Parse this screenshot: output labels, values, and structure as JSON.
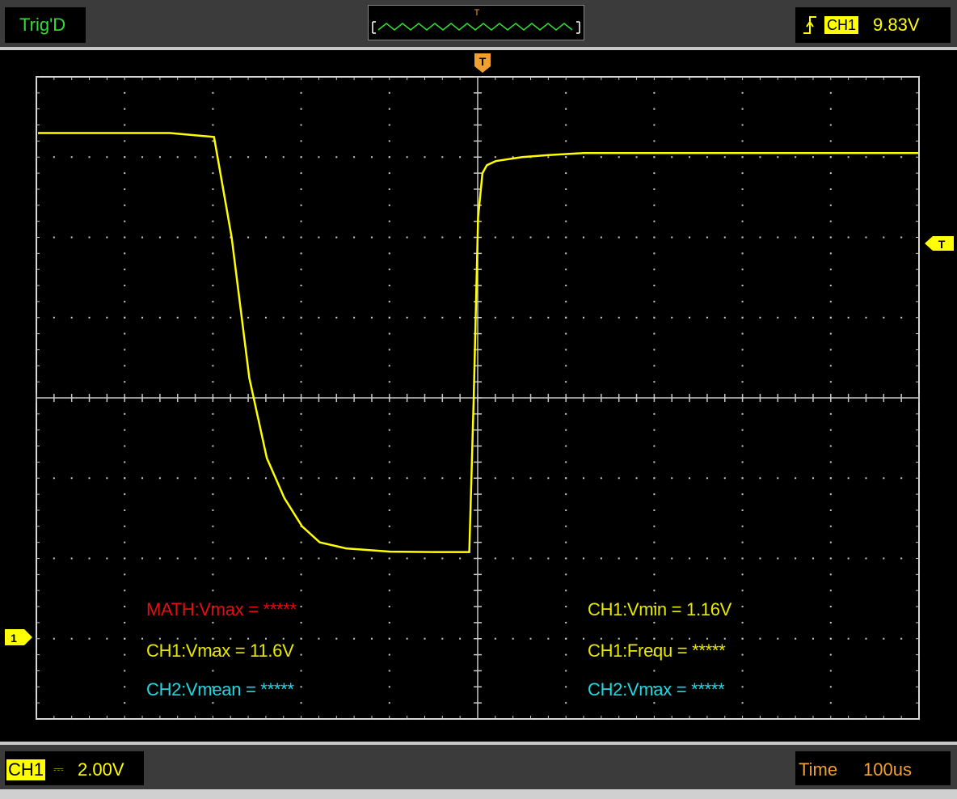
{
  "header": {
    "trigger_status": "Trig'D",
    "timeline_trigger_marker": "T",
    "trigger_source": "CH1",
    "trigger_level": "9.83V",
    "trigger_edge_icon": "rising-edge-icon"
  },
  "markers": {
    "trigger_position": "T",
    "trigger_level_marker": "T",
    "channel1_ground": "1"
  },
  "measurements": {
    "math_vmax": "MATH:Vmax = *****",
    "ch1_vmax": "CH1:Vmax = 11.6V",
    "ch2_vmean": "CH2:Vmean = *****",
    "ch1_vmin": "CH1:Vmin = 1.16V",
    "ch1_frequ": "CH1:Frequ = *****",
    "ch2_vmax": "CH2:Vmax = *****"
  },
  "footer": {
    "channel": "CH1",
    "coupling": "⎓",
    "volts_per_div": "2.00V",
    "time_label": "Time",
    "time_per_div": "100us"
  },
  "colors": {
    "ch1": "#ffff00",
    "ch2": "#20d8e0",
    "math": "#e01010",
    "trigger": "#f0a030",
    "status_ok": "#33dd33",
    "grid": "#c8c8c8"
  },
  "chart_data": {
    "type": "line",
    "series": [
      {
        "name": "CH1",
        "x": [
          -500,
          -350,
          -300,
          -280,
          -260,
          -240,
          -220,
          -200,
          -180,
          -150,
          -100,
          -50,
          -20,
          -10,
          -5,
          0,
          5,
          10,
          20,
          50,
          80,
          120,
          200,
          300,
          400,
          500
        ],
        "y": [
          11.6,
          11.6,
          11.5,
          9.0,
          5.5,
          3.5,
          2.5,
          1.8,
          1.4,
          1.25,
          1.17,
          1.16,
          1.16,
          1.16,
          5.0,
          9.5,
          10.6,
          10.8,
          10.9,
          11.0,
          11.05,
          11.1,
          11.1,
          11.1,
          11.1,
          11.1
        ]
      }
    ],
    "x_unit": "us",
    "y_unit": "V",
    "xlim": [
      -500,
      500
    ],
    "ylim": [
      -3.0,
      13.0
    ],
    "grid": true,
    "legend": "none"
  }
}
